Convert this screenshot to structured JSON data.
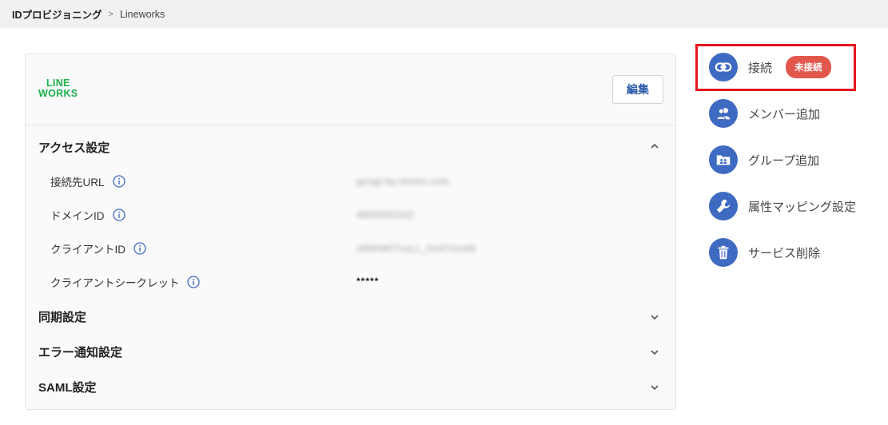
{
  "breadcrumb": {
    "root": "IDプロビジョニング",
    "separator": ">",
    "current": "Lineworks"
  },
  "logo": {
    "line1": "LINE",
    "line2": "WORKS"
  },
  "edit_label": "編集",
  "sections": {
    "access": "アクセス設定",
    "sync": "同期設定",
    "error": "エラー通知設定",
    "saml": "SAML設定"
  },
  "access_rows": [
    {
      "label": "接続先URL",
      "value": "googl-by-works.com"
    },
    {
      "label": "ドメインID",
      "value": "4800093332"
    },
    {
      "label": "クライアントID",
      "value": "s8NhWl7nuLL_hn4Yrtvalk"
    },
    {
      "label": "クライアントシークレット",
      "value": "*****"
    }
  ],
  "side_menu": [
    {
      "label": "接続",
      "icon": "link-icon",
      "badge": "未接続"
    },
    {
      "label": "メンバー追加",
      "icon": "members-icon"
    },
    {
      "label": "グループ追加",
      "icon": "group-folder-icon"
    },
    {
      "label": "属性マッピング設定",
      "icon": "wrench-icon"
    },
    {
      "label": "サービス削除",
      "icon": "trash-icon"
    }
  ],
  "colors": {
    "accent": "#3f6ac2",
    "badge": "#e2574c",
    "highlight": "#e4141d",
    "logo": "#19b24b"
  }
}
